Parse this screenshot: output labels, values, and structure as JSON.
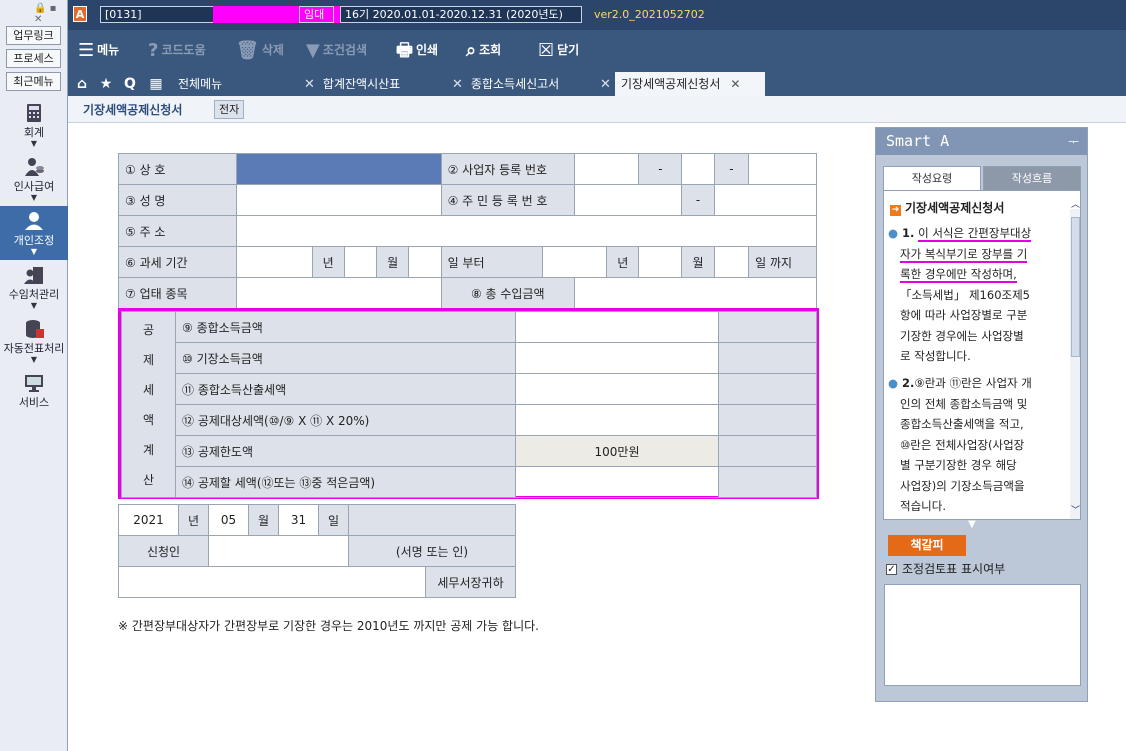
{
  "titlebar": {
    "app_icon": "A",
    "code": "[0131]",
    "company_type": "임대",
    "period": "16기 2020.01.01-2020.12.31 (2020년도)",
    "version": "ver2.0_2021052702"
  },
  "leftpanel": {
    "quick_buttons": [
      "업무링크",
      "프로세스",
      "최근메뉴"
    ],
    "nav": [
      {
        "label": "회계",
        "icon": "calculator-icon"
      },
      {
        "label": "인사급여",
        "icon": "person-coins-icon"
      },
      {
        "label": "개인조정",
        "icon": "person-icon"
      },
      {
        "label": "수임처관리",
        "icon": "building-person-icon"
      },
      {
        "label": "자동전표처리",
        "icon": "database-icon"
      },
      {
        "label": "서비스",
        "icon": "monitor-icon"
      }
    ],
    "active_index": 2
  },
  "toolbar": {
    "menu": "메뉴",
    "code_help": "코드도움",
    "delete": "삭제",
    "filter": "조건검색",
    "print": "인쇄",
    "inquire": "조회",
    "close": "닫기"
  },
  "tabs": {
    "home_menu": "전체메뉴",
    "items": [
      {
        "label": "합계잔액시산표"
      },
      {
        "label": "종합소득세신고서"
      },
      {
        "label": "기장세액공제신청서"
      }
    ]
  },
  "subheader": {
    "title": "기장세액공제신청서",
    "badge": "전자"
  },
  "form": {
    "row1": {
      "label1": "① 상 호",
      "label2": "② 사업자 등록 번호",
      "dash": "-"
    },
    "row2": {
      "label1": "③ 성 명",
      "label2": "④ 주 민 등 록 번 호",
      "dash": "-"
    },
    "row3": {
      "label1": "⑤ 주 소"
    },
    "row4": {
      "label1": "⑥ 과세 기간",
      "year": "년",
      "month": "월",
      "day_from": "일 부터",
      "day_to": "일 까지"
    },
    "row5": {
      "label1": "⑦ 업태 종목",
      "label2": "⑧ 총 수입금액"
    },
    "calc_group": [
      "공",
      "제",
      "세",
      "액",
      "계",
      "산"
    ],
    "calc_rows": [
      {
        "label": "⑨ 종합소득금액",
        "value": ""
      },
      {
        "label": "⑩ 기장소득금액",
        "value": ""
      },
      {
        "label": "⑪ 종합소득산출세액",
        "value": ""
      },
      {
        "label": "⑫ 공제대상세액(⑩/⑨ X ⑪ X 20%)",
        "value": ""
      },
      {
        "label": "⑬ 공제한도액",
        "value": "100만원"
      },
      {
        "label": "⑭ 공제할 세액(⑫또는 ⑬중 적은금액)",
        "value": ""
      }
    ],
    "date": {
      "year": "2021",
      "year_label": "년",
      "month": "05",
      "month_label": "월",
      "day": "31",
      "day_label": "일"
    },
    "applicant_label": "신청인",
    "signature_label": "(서명 또는 인)",
    "tax_office_label": "세무서장귀하",
    "note": "※ 간편장부대상자가 간편장부로 기장한 경우는 2010년도 까지만 공제 가능 합니다."
  },
  "smart": {
    "title": "Smart A",
    "pin": "ᅮ",
    "tab_active": "작성요령",
    "tab_inactive": "작성흐름",
    "section_title": "기장세액공제신청서",
    "p1_num": "1.",
    "p1_lines": [
      "이 서식은 간편장부대상",
      "자가 복식부기로 장부를 기",
      "록한 경우에만 작성하며,",
      "「소득세법」 제160조제5",
      "항에 따라 사업장별로 구분",
      "기장한 경우에는 사업장별",
      "로 작성합니다."
    ],
    "p2_num": "2.",
    "p2_lines": [
      "⑨란과 ⑪란은 사업자 개",
      "인의 전체 종합소득금액 및",
      "종합소득산출세액을 적고,",
      "⑩란은 전체사업장(사업장",
      "별 구분기장한 경우 해당",
      "사업장)의 기장소득금액을",
      "적습니다."
    ],
    "bookmark": "책갈피",
    "checkbox_label": "조정검토표 표시여부",
    "checkbox_checked": true
  }
}
